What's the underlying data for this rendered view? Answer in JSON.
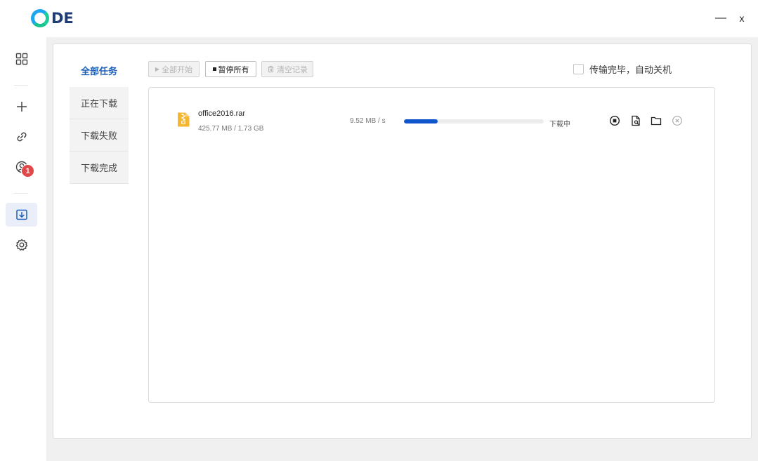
{
  "app": {
    "logo_text": "DE"
  },
  "window": {
    "minimize_glyph": "—",
    "close_glyph": "x"
  },
  "sidebar": {
    "items": [
      {
        "icon": "apps-icon"
      },
      {
        "icon": "plus-icon"
      },
      {
        "icon": "link-icon"
      },
      {
        "icon": "user-icon"
      },
      {
        "icon": "download-icon",
        "badge": "1",
        "active": true
      },
      {
        "icon": "gear-icon"
      }
    ]
  },
  "categories": [
    {
      "label": "全部任务",
      "active": true
    },
    {
      "label": "正在下载"
    },
    {
      "label": "下载失败"
    },
    {
      "label": "下载完成"
    }
  ],
  "toolbar": {
    "start_all": "全部开始",
    "pause_all": "暂停所有",
    "clear_records": "清空记录",
    "shutdown_label": "传输完毕，自动关机"
  },
  "tasks": [
    {
      "name": "office2016.rar",
      "size": "425.77 MB / 1.73 GB",
      "speed": "9.52 MB / s",
      "progress_percent": 24,
      "status": "下载中"
    }
  ],
  "colors": {
    "accent": "#1155cc",
    "badge": "#e04848",
    "file_icon": "#f5b731"
  }
}
